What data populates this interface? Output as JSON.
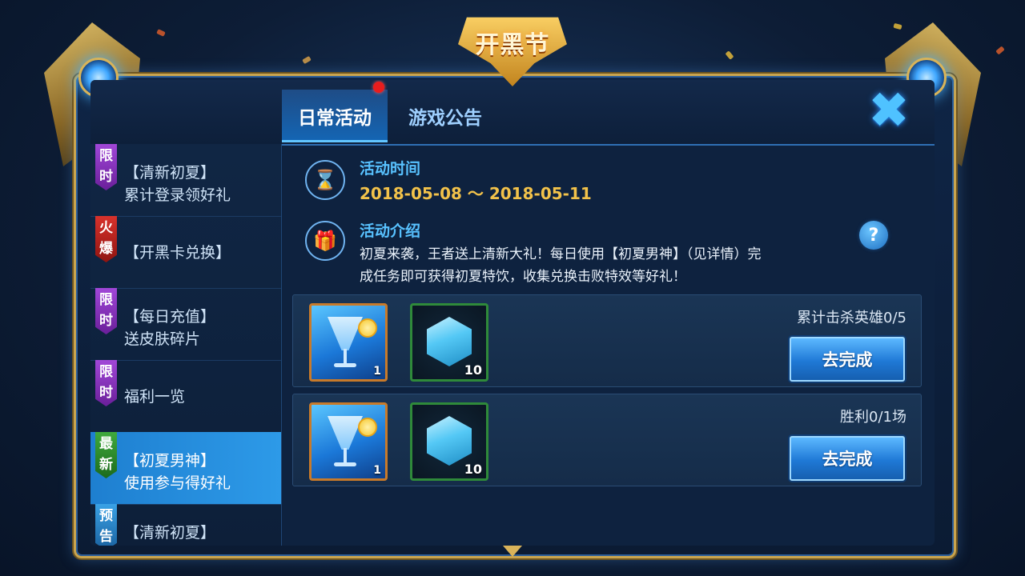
{
  "emblem": {
    "title": "开黑节"
  },
  "tabs": [
    {
      "label": "日常活动",
      "active": true,
      "has_red_dot": true
    },
    {
      "label": "游戏公告",
      "active": false
    }
  ],
  "sidebar": {
    "items": [
      {
        "badge": "限时",
        "badge_color": "#8e35c4",
        "line1": "【清新初夏】",
        "line2": "累计登录领好礼",
        "active": false
      },
      {
        "badge": "火爆",
        "badge_color": "#c22820",
        "line1": "【开黑卡兑换】",
        "line2": "",
        "active": false
      },
      {
        "badge": "限时",
        "badge_color": "#8e35c4",
        "line1": "【每日充值】",
        "line2": "送皮肤碎片",
        "active": false
      },
      {
        "badge": "限时",
        "badge_color": "#8e35c4",
        "line1": "福利一览",
        "line2": "",
        "active": false
      },
      {
        "badge": "最新",
        "badge_color": "#2f8f2d",
        "line1": "【初夏男神】",
        "line2": "使用参与得好礼",
        "active": true
      },
      {
        "badge": "预告",
        "badge_color": "#2a86cc",
        "line1": "【清新初夏】",
        "line2": "",
        "active": false
      }
    ]
  },
  "activity": {
    "time_title": "活动时间",
    "date_range": "2018-05-08 ～ 2018-05-11",
    "intro_title": "活动介绍",
    "intro_line1": "初夏来袭，王者送上清新大礼！每日使用【初夏男神】（见详情）完",
    "intro_line2": "成任务即可获得初夏特饮，收集兑换击败特效等好礼！",
    "help_symbol": "?"
  },
  "tasks": [
    {
      "label": "累计击杀英雄0/5",
      "button": "去完成",
      "rewards": [
        {
          "name": "summer-drink",
          "qty": "1"
        },
        {
          "name": "crystal",
          "qty": "10"
        }
      ]
    },
    {
      "label": "胜利0/1场",
      "button": "去完成",
      "rewards": [
        {
          "name": "summer-drink",
          "qty": "1"
        },
        {
          "name": "crystal",
          "qty": "10"
        }
      ]
    }
  ],
  "icons": {
    "close": "close-icon",
    "hourglass": "hourglass-icon",
    "gift": "gift-icon",
    "help": "question-icon"
  },
  "colors": {
    "accent_blue": "#1f79d6",
    "date_gold": "#f2c24a",
    "title_blue": "#58c2ff",
    "frame_gold": "#c9a44e"
  }
}
